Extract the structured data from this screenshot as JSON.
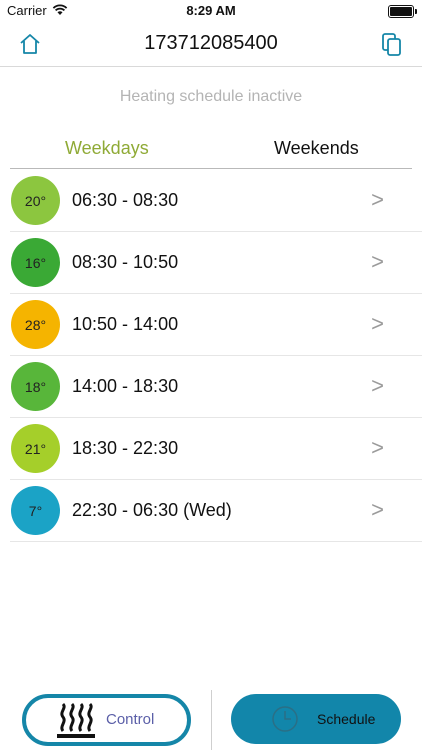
{
  "status_bar": {
    "carrier": "Carrier",
    "time": "8:29 AM"
  },
  "nav": {
    "title": "173712085400"
  },
  "schedule_state": "Heating schedule inactive",
  "tabs": [
    {
      "label": "Weekdays",
      "selected": true
    },
    {
      "label": "Weekends",
      "selected": false
    }
  ],
  "entries": [
    {
      "temp": "20°",
      "range": "06:30 - 08:30",
      "color": "#8cc63f"
    },
    {
      "temp": "16°",
      "range": "08:30 - 10:50",
      "color": "#3aa935"
    },
    {
      "temp": "28°",
      "range": "10:50 - 14:00",
      "color": "#f5b400"
    },
    {
      "temp": "18°",
      "range": "14:00 - 18:30",
      "color": "#58b63a"
    },
    {
      "temp": "21°",
      "range": "18:30 - 22:30",
      "color": "#a5cf2a"
    },
    {
      "temp": "7°",
      "range": "22:30 - 06:30 (Wed)",
      "color": "#1ba3c6"
    }
  ],
  "chevron": ">",
  "bottom": {
    "control_label": "Control",
    "schedule_label": "Schedule"
  },
  "colors": {
    "accent": "#1586a8",
    "tab_selected": "#8faa36"
  }
}
